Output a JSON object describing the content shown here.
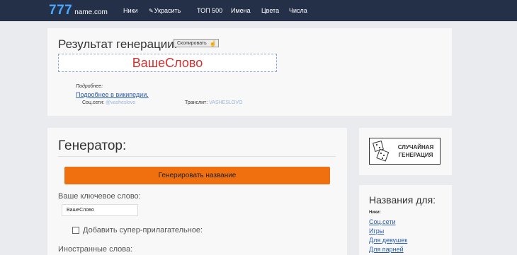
{
  "logo": {
    "number": "777",
    "name": "name.com"
  },
  "nav": [
    {
      "icon": "",
      "label": "Ники"
    },
    {
      "icon": "✎",
      "label": "Украсить"
    },
    {
      "icon": "",
      "label": "ТОП 500"
    },
    {
      "icon": "",
      "label": "Имена"
    },
    {
      "icon": "",
      "label": "Цвета"
    },
    {
      "icon": "",
      "label": "Числа"
    }
  ],
  "result": {
    "title": "Результат генерации:",
    "copy_label": "Скопировать",
    "copy_icon": "hand-pointer-icon",
    "word": "ВашеСлово",
    "more_label": "Подробнее:",
    "wiki_link": "Подробнее в википедии.",
    "social_label": "Соц.сети:",
    "social_value": "@vasheslovo",
    "translit_label": "Транслит:",
    "translit_value": "VASHESLOVO"
  },
  "generator": {
    "title": "Генератор:",
    "button": "Генерировать название",
    "keyword_label": "Ваше ключевое слово:",
    "keyword_value": "ВашеСлово",
    "checkbox_label": "Добавить супер-прилагательное:",
    "checkbox_checked": false,
    "foreign_label": "Иностранные слова:"
  },
  "sidebar": {
    "random_line1": "СЛУЧАЙНАЯ",
    "random_line2": "ГЕНЕРАЦИЯ",
    "names_title": "Названия для:",
    "nicks_label": "Ники:",
    "links": [
      "Соц.сети",
      "Игры",
      "Для девушек",
      "Для парней"
    ]
  },
  "colors": {
    "topbar": "#233047",
    "logo_accent": "#4aa8ff",
    "generate_button": "#f07010",
    "result_word": "#d0302e",
    "link": "#2a5db0"
  }
}
